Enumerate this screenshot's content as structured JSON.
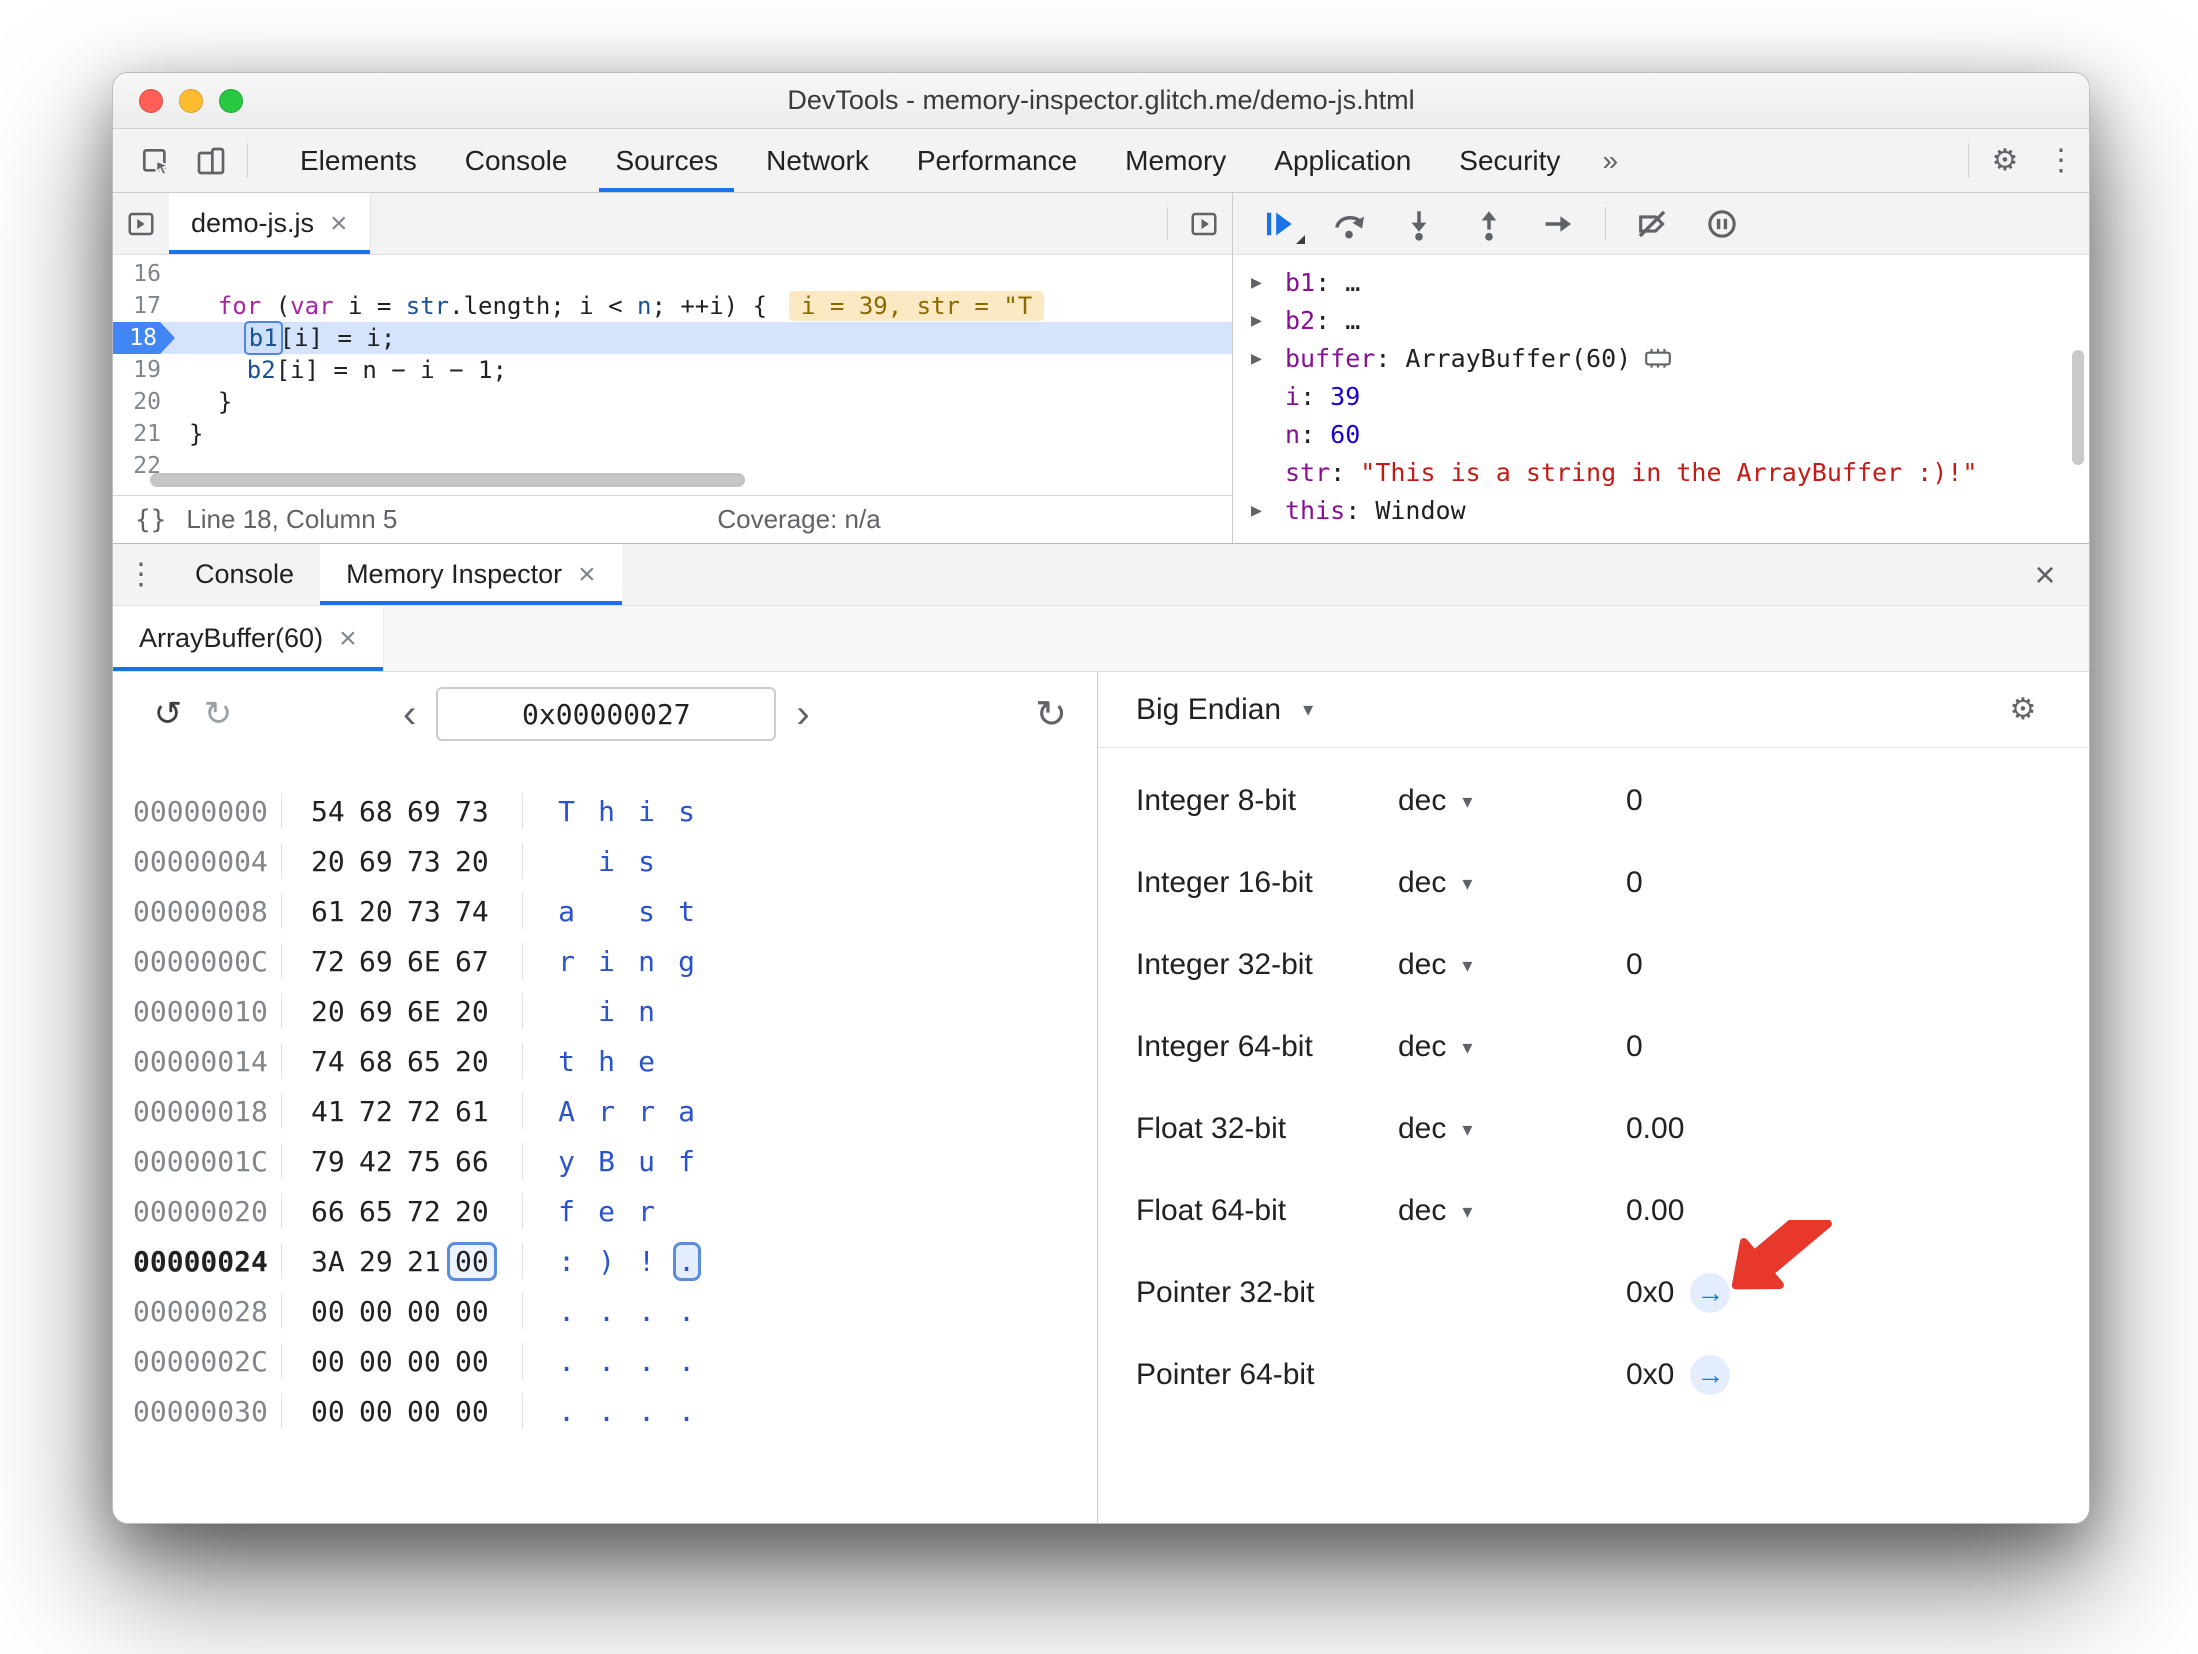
{
  "colors": {
    "accent": "#1a73e8",
    "annotation": "#e8382c",
    "exec_line_bg": "#d5e4fc",
    "eval_chip_bg": "#fbe9c4"
  },
  "glyphs": {
    "undo": "↺",
    "redo": "↻",
    "refresh": "↻",
    "prev": "‹",
    "next": "›",
    "caret_down": "▾",
    "gear": "⚙",
    "kebab": "⋮",
    "disclosure": "▶",
    "close": "×",
    "braces": "{}",
    "jump_arrow": "→"
  },
  "titlebar": {
    "title": "DevTools - memory-inspector.glitch.me/demo-js.html"
  },
  "main_toolbar": {
    "tabs": [
      {
        "label": "Elements",
        "active": false
      },
      {
        "label": "Console",
        "active": false
      },
      {
        "label": "Sources",
        "active": true
      },
      {
        "label": "Network",
        "active": false
      },
      {
        "label": "Performance",
        "active": false
      },
      {
        "label": "Memory",
        "active": false
      },
      {
        "label": "Application",
        "active": false
      },
      {
        "label": "Security",
        "active": false
      }
    ],
    "more": "»"
  },
  "sources": {
    "file_tab": {
      "label": "demo-js.js",
      "close": "×"
    },
    "lines": [
      {
        "num": "16",
        "tokens": []
      },
      {
        "num": "17",
        "tokens": [
          {
            "t": "  ",
            "c": "pl"
          },
          {
            "t": "for",
            "c": "kw"
          },
          {
            "t": " (",
            "c": "pl"
          },
          {
            "t": "var",
            "c": "kw"
          },
          {
            "t": " i = ",
            "c": "pl"
          },
          {
            "t": "str",
            "c": "vr"
          },
          {
            "t": ".length; i < ",
            "c": "pl"
          },
          {
            "t": "n",
            "c": "vr"
          },
          {
            "t": "; ++i) {",
            "c": "pl"
          }
        ],
        "eval": "i = 39, str = \"T"
      },
      {
        "num": "18",
        "exec": true,
        "tokens": [
          {
            "t": "    ",
            "c": "pl"
          },
          {
            "t": "b1",
            "c": "vr boxed"
          },
          {
            "t": "[i] = i;",
            "c": "pl"
          }
        ]
      },
      {
        "num": "19",
        "tokens": [
          {
            "t": "    ",
            "c": "pl"
          },
          {
            "t": "b2",
            "c": "vr"
          },
          {
            "t": "[i] = n − i − 1;",
            "c": "pl"
          }
        ]
      },
      {
        "num": "20",
        "tokens": [
          {
            "t": "  }",
            "c": "pl"
          }
        ]
      },
      {
        "num": "21",
        "tokens": [
          {
            "t": "}",
            "c": "pl"
          }
        ]
      },
      {
        "num": "22",
        "tokens": []
      }
    ],
    "status": {
      "line_col": "Line 18, Column 5",
      "coverage": "Coverage: n/a"
    }
  },
  "debugger": {
    "scope_items": [
      {
        "arrow": true,
        "name": "b1",
        "value": "…",
        "vtype": "obj"
      },
      {
        "arrow": true,
        "name": "b2",
        "value": "…",
        "vtype": "obj"
      },
      {
        "arrow": true,
        "name": "buffer",
        "value": "ArrayBuffer(60)",
        "vtype": "obj",
        "memory_icon": true
      },
      {
        "arrow": false,
        "name": "i",
        "value": "39",
        "vtype": "num"
      },
      {
        "arrow": false,
        "name": "n",
        "value": "60",
        "vtype": "num"
      },
      {
        "arrow": false,
        "name": "str",
        "value": "\"This is a string in the ArrayBuffer :)!\"",
        "vtype": "str"
      },
      {
        "arrow": true,
        "name": "this",
        "value": "Window",
        "vtype": "obj"
      }
    ]
  },
  "drawer": {
    "tabs": [
      {
        "label": "Console",
        "active": false
      },
      {
        "label": "Memory Inspector",
        "active": true,
        "close": "×"
      }
    ],
    "close": "×"
  },
  "memory": {
    "buffer_tab": {
      "label": "ArrayBuffer(60)",
      "close": "×"
    },
    "address_value": "0x00000027",
    "endianness": "Big Endian",
    "rows": [
      {
        "addr": "00000000",
        "bytes": [
          "54",
          "68",
          "69",
          "73"
        ],
        "ascii": [
          "T",
          "h",
          "i",
          "s"
        ]
      },
      {
        "addr": "00000004",
        "bytes": [
          "20",
          "69",
          "73",
          "20"
        ],
        "ascii": [
          " ",
          "i",
          "s",
          " "
        ]
      },
      {
        "addr": "00000008",
        "bytes": [
          "61",
          "20",
          "73",
          "74"
        ],
        "ascii": [
          "a",
          " ",
          "s",
          "t"
        ]
      },
      {
        "addr": "0000000C",
        "bytes": [
          "72",
          "69",
          "6E",
          "67"
        ],
        "ascii": [
          "r",
          "i",
          "n",
          "g"
        ]
      },
      {
        "addr": "00000010",
        "bytes": [
          "20",
          "69",
          "6E",
          "20"
        ],
        "ascii": [
          " ",
          "i",
          "n",
          " "
        ]
      },
      {
        "addr": "00000014",
        "bytes": [
          "74",
          "68",
          "65",
          "20"
        ],
        "ascii": [
          "t",
          "h",
          "e",
          " "
        ]
      },
      {
        "addr": "00000018",
        "bytes": [
          "41",
          "72",
          "72",
          "61"
        ],
        "ascii": [
          "A",
          "r",
          "r",
          "a"
        ]
      },
      {
        "addr": "0000001C",
        "bytes": [
          "79",
          "42",
          "75",
          "66"
        ],
        "ascii": [
          "y",
          "B",
          "u",
          "f"
        ]
      },
      {
        "addr": "00000020",
        "bytes": [
          "66",
          "65",
          "72",
          "20"
        ],
        "ascii": [
          "f",
          "e",
          "r",
          " "
        ]
      },
      {
        "addr": "00000024",
        "bytes": [
          "3A",
          "29",
          "21",
          "00"
        ],
        "ascii": [
          ":",
          ")",
          "!",
          "."
        ],
        "current": true,
        "selected": 3
      },
      {
        "addr": "00000028",
        "bytes": [
          "00",
          "00",
          "00",
          "00"
        ],
        "ascii": [
          ".",
          ".",
          ".",
          "."
        ]
      },
      {
        "addr": "0000002C",
        "bytes": [
          "00",
          "00",
          "00",
          "00"
        ],
        "ascii": [
          ".",
          ".",
          ".",
          "."
        ]
      },
      {
        "addr": "00000030",
        "bytes": [
          "00",
          "00",
          "00",
          "00"
        ],
        "ascii": [
          ".",
          ".",
          ".",
          "."
        ]
      }
    ],
    "value_rows": [
      {
        "label": "Integer 8-bit",
        "format": "dec",
        "value": "0"
      },
      {
        "label": "Integer 16-bit",
        "format": "dec",
        "value": "0"
      },
      {
        "label": "Integer 32-bit",
        "format": "dec",
        "value": "0"
      },
      {
        "label": "Integer 64-bit",
        "format": "dec",
        "value": "0"
      },
      {
        "label": "Float 32-bit",
        "format": "dec",
        "value": "0.00"
      },
      {
        "label": "Float 64-bit",
        "format": "dec",
        "value": "0.00"
      },
      {
        "label": "Pointer 32-bit",
        "format": "",
        "value": "0x0",
        "jump": true
      },
      {
        "label": "Pointer 64-bit",
        "format": "",
        "value": "0x0",
        "jump": true
      }
    ]
  }
}
